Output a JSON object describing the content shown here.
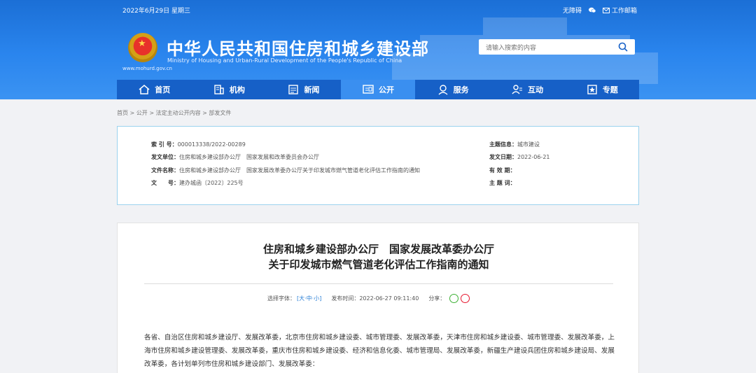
{
  "topbar": {
    "date": "2022年6月29日 星期三",
    "accessibility": "无障碍",
    "email": "工作邮箱"
  },
  "site": {
    "url": "www.mohurd.gov.cn",
    "title": "中华人民共和国住房和城乡建设部",
    "subtitle_en": "Ministry of Housing and Urban-Rural Development of the People's Republic of China"
  },
  "search": {
    "placeholder": "请输入搜索的内容"
  },
  "nav": [
    {
      "label": "首页",
      "icon": "home-icon"
    },
    {
      "label": "机构",
      "icon": "building-icon"
    },
    {
      "label": "新闻",
      "icon": "news-icon"
    },
    {
      "label": "公开",
      "icon": "open-icon"
    },
    {
      "label": "服务",
      "icon": "service-icon"
    },
    {
      "label": "互动",
      "icon": "interact-icon"
    },
    {
      "label": "专题",
      "icon": "topic-icon"
    }
  ],
  "breadcrumb": "首页 > 公开 > 法定主动公开内容 > 部发文件",
  "meta": {
    "index_k": "索 引 号：",
    "index_v": "000013338/2022-00289",
    "issuer_k": "发文单位：",
    "issuer_v": "住房和城乡建设部办公厅　国家发展和改革委员会办公厅",
    "name_k": "文件名称：",
    "name_v": "住房和城乡建设部办公厅　国家发展改革委办公厅关于印发城市燃气管道老化评估工作指南的通知",
    "docno_k": "文　　号：",
    "docno_v": "建办城函〔2022〕225号",
    "topic_k": "主题信息：",
    "topic_v": "城市建设",
    "date_k": "发文日期：",
    "date_v": "2022-06-21",
    "valid_k": "有 效 期：",
    "valid_v": "",
    "keyword_k": "主 题 词：",
    "keyword_v": ""
  },
  "article": {
    "title_line1": "住房和城乡建设部办公厅　国家发展改革委办公厅",
    "title_line2": "关于印发城市燃气管道老化评估工作指南的通知",
    "font_label": "选择字体：",
    "size_l": "大",
    "size_m": "中",
    "size_s": "小",
    "publish_label": "发布时间：",
    "publish_time": "2022-06-27 09:11:40",
    "share_label": "分享：",
    "body": "各省、自治区住房和城乡建设厅、发展改革委，北京市住房和城乡建设委、城市管理委、发展改革委，天津市住房和城乡建设委、城市管理委、发展改革委，上海市住房和城乡建设管理委、发展改革委，重庆市住房和城乡建设委、经济和信息化委、城市管理局、发展改革委，新疆生产建设兵团住房和城乡建设局、发展改革委，各计划单列市住房和城乡建设部门、发展改革委："
  },
  "colors": {
    "header": "#2a85ee",
    "nav": "#1660c7",
    "nav_active": "#3a8ff0",
    "meta_border": "#9bd2ee"
  }
}
